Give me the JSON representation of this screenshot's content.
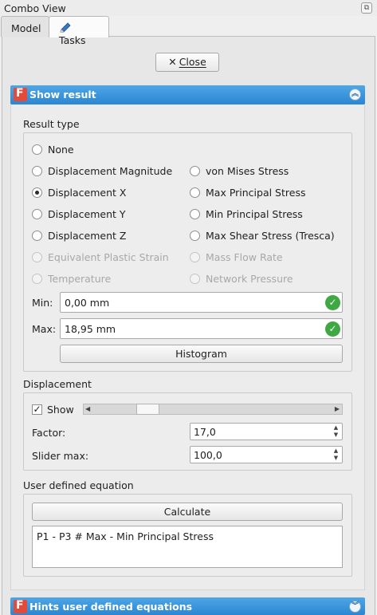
{
  "window": {
    "title": "Combo View"
  },
  "tabs": [
    {
      "label": "Model"
    },
    {
      "label": "Tasks"
    }
  ],
  "close_button": {
    "label": "Close"
  },
  "show_result": {
    "title": "Show result",
    "result_type": {
      "title": "Result type",
      "options": [
        {
          "label": "None",
          "checked": false,
          "enabled": true
        },
        {
          "label": "Displacement Magnitude",
          "checked": false,
          "enabled": true
        },
        {
          "label": "von Mises Stress",
          "checked": false,
          "enabled": true
        },
        {
          "label": "Displacement X",
          "checked": true,
          "enabled": true
        },
        {
          "label": "Max Principal Stress",
          "checked": false,
          "enabled": true
        },
        {
          "label": "Displacement Y",
          "checked": false,
          "enabled": true
        },
        {
          "label": "Min Principal Stress",
          "checked": false,
          "enabled": true
        },
        {
          "label": "Displacement Z",
          "checked": false,
          "enabled": true
        },
        {
          "label": "Max Shear Stress (Tresca)",
          "checked": false,
          "enabled": true
        },
        {
          "label": "Equivalent Plastic Strain",
          "checked": false,
          "enabled": false
        },
        {
          "label": "Mass Flow Rate",
          "checked": false,
          "enabled": false
        },
        {
          "label": "Temperature",
          "checked": false,
          "enabled": false
        },
        {
          "label": "Network Pressure",
          "checked": false,
          "enabled": false
        }
      ],
      "min_label": "Min:",
      "min_value": "0,00 mm",
      "max_label": "Max:",
      "max_value": "18,95 mm",
      "histogram_label": "Histogram"
    },
    "displacement": {
      "title": "Displacement",
      "show_label": "Show",
      "show_checked": true,
      "slider_position": 0.2,
      "factor_label": "Factor:",
      "factor_value": "17,0",
      "slider_max_label": "Slider max:",
      "slider_max_value": "100,0"
    },
    "user_equation": {
      "title": "User defined equation",
      "calculate_label": "Calculate",
      "equation_text": "P1 - P3 # Max - Min Principal Stress"
    }
  },
  "hints": {
    "title": "Hints user defined equations"
  },
  "colors": {
    "section_header": "#2b86d2",
    "ok_green": "#3fa843",
    "freecad_red": "#e24a3a"
  },
  "icons": {
    "tab_tasks": "pencil-icon",
    "close": "x-icon",
    "collapse": "chevron-up-icon",
    "expand": "chevron-down-icon",
    "valid": "checkmark-icon"
  }
}
